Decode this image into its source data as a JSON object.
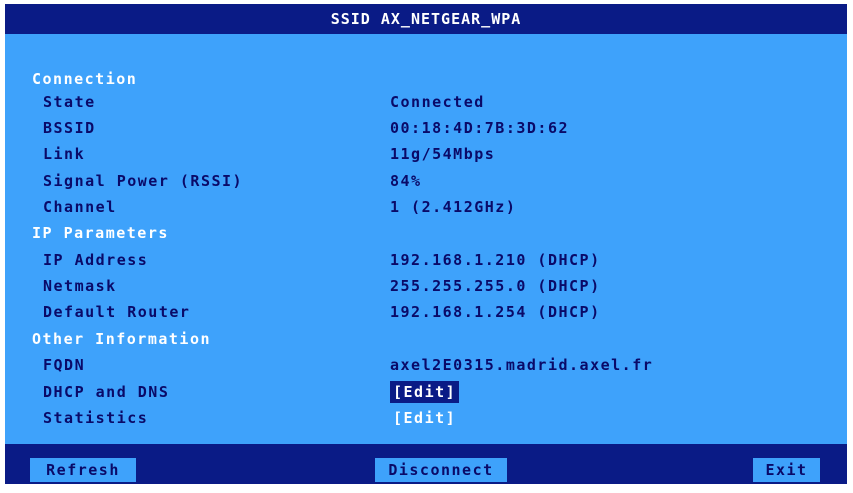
{
  "title": "SSID AX_NETGEAR_WPA",
  "sections": {
    "connection": {
      "heading": "Connection",
      "state_label": "State",
      "state_value": "Connected",
      "bssid_label": "BSSID",
      "bssid_value": "00:18:4D:7B:3D:62",
      "link_label": "Link",
      "link_value": "11g/54Mbps",
      "signal_label": "Signal Power (RSSI)",
      "signal_value": "84%",
      "channel_label": "Channel",
      "channel_value": "1 (2.412GHz)"
    },
    "ip": {
      "heading": "IP Parameters",
      "address_label": "IP Address",
      "address_value": "192.168.1.210 (DHCP)",
      "netmask_label": "Netmask",
      "netmask_value": "255.255.255.0 (DHCP)",
      "router_label": "Default Router",
      "router_value": "192.168.1.254 (DHCP)"
    },
    "other": {
      "heading": "Other Information",
      "fqdn_label": "FQDN",
      "fqdn_value": "axel2E0315.madrid.axel.fr",
      "dhcp_dns_label": "DHCP and DNS",
      "dhcp_dns_action": "[Edit]",
      "statistics_label": "Statistics",
      "statistics_action": "[Edit]"
    }
  },
  "footer": {
    "refresh_label": "Refresh",
    "disconnect_label": "Disconnect",
    "exit_label": "Exit"
  },
  "colors": {
    "background": "#3ea2fb",
    "bar": "#0a1b86",
    "text_dark": "#0a0a68",
    "text_light": "#ffffff"
  }
}
